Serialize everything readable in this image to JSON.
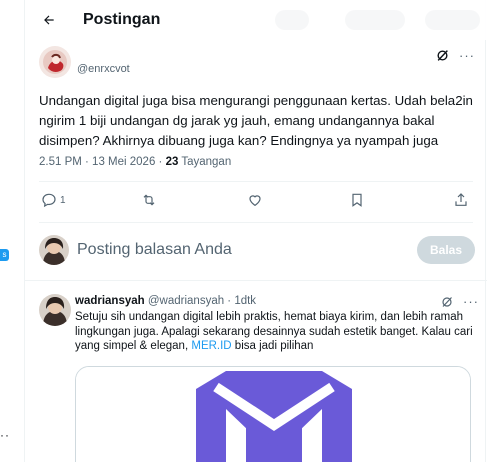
{
  "header": {
    "title": "Postingan"
  },
  "post": {
    "handle": "@enrxcvot",
    "text": "Undangan digital juga bisa mengurangi penggunaan kertas. Udah bela2in ngirim 1 biji undangan dg jarak yg jauh, emang undangannya bakal disimpen? Akhirnya dibuang juga kan? Endingnya ya nyampah juga",
    "time": "2.51 PM · 13 Mei 2026 · ",
    "views_count": "23",
    "views_label": " Tayangan",
    "reply_count": "1"
  },
  "composer": {
    "placeholder": "Posting balasan Anda",
    "button_label": "Balas"
  },
  "reply": {
    "name": "wadriansyah",
    "handle_meta": " @wadriansyah · 1dtk",
    "text_before_link": "Setuju sih undangan digital lebih praktis, hemat biaya kirim, dan lebih ramah lingkungan juga. Apalagi sekarang desainnya sudah estetik banget. Kalau cari yang simpel & elegan, ",
    "link": "MER.ID",
    "text_after_link": " bisa jadi pilihan"
  },
  "left_badge": "s",
  "colors": {
    "accent": "#1d9bf0",
    "brand_purple": "#6a5ad8",
    "muted": "#536471"
  },
  "icons": [
    "back-arrow-icon",
    "grok-icon",
    "more-icon",
    "reply-icon",
    "repost-icon",
    "like-icon",
    "bookmark-icon",
    "share-icon"
  ]
}
